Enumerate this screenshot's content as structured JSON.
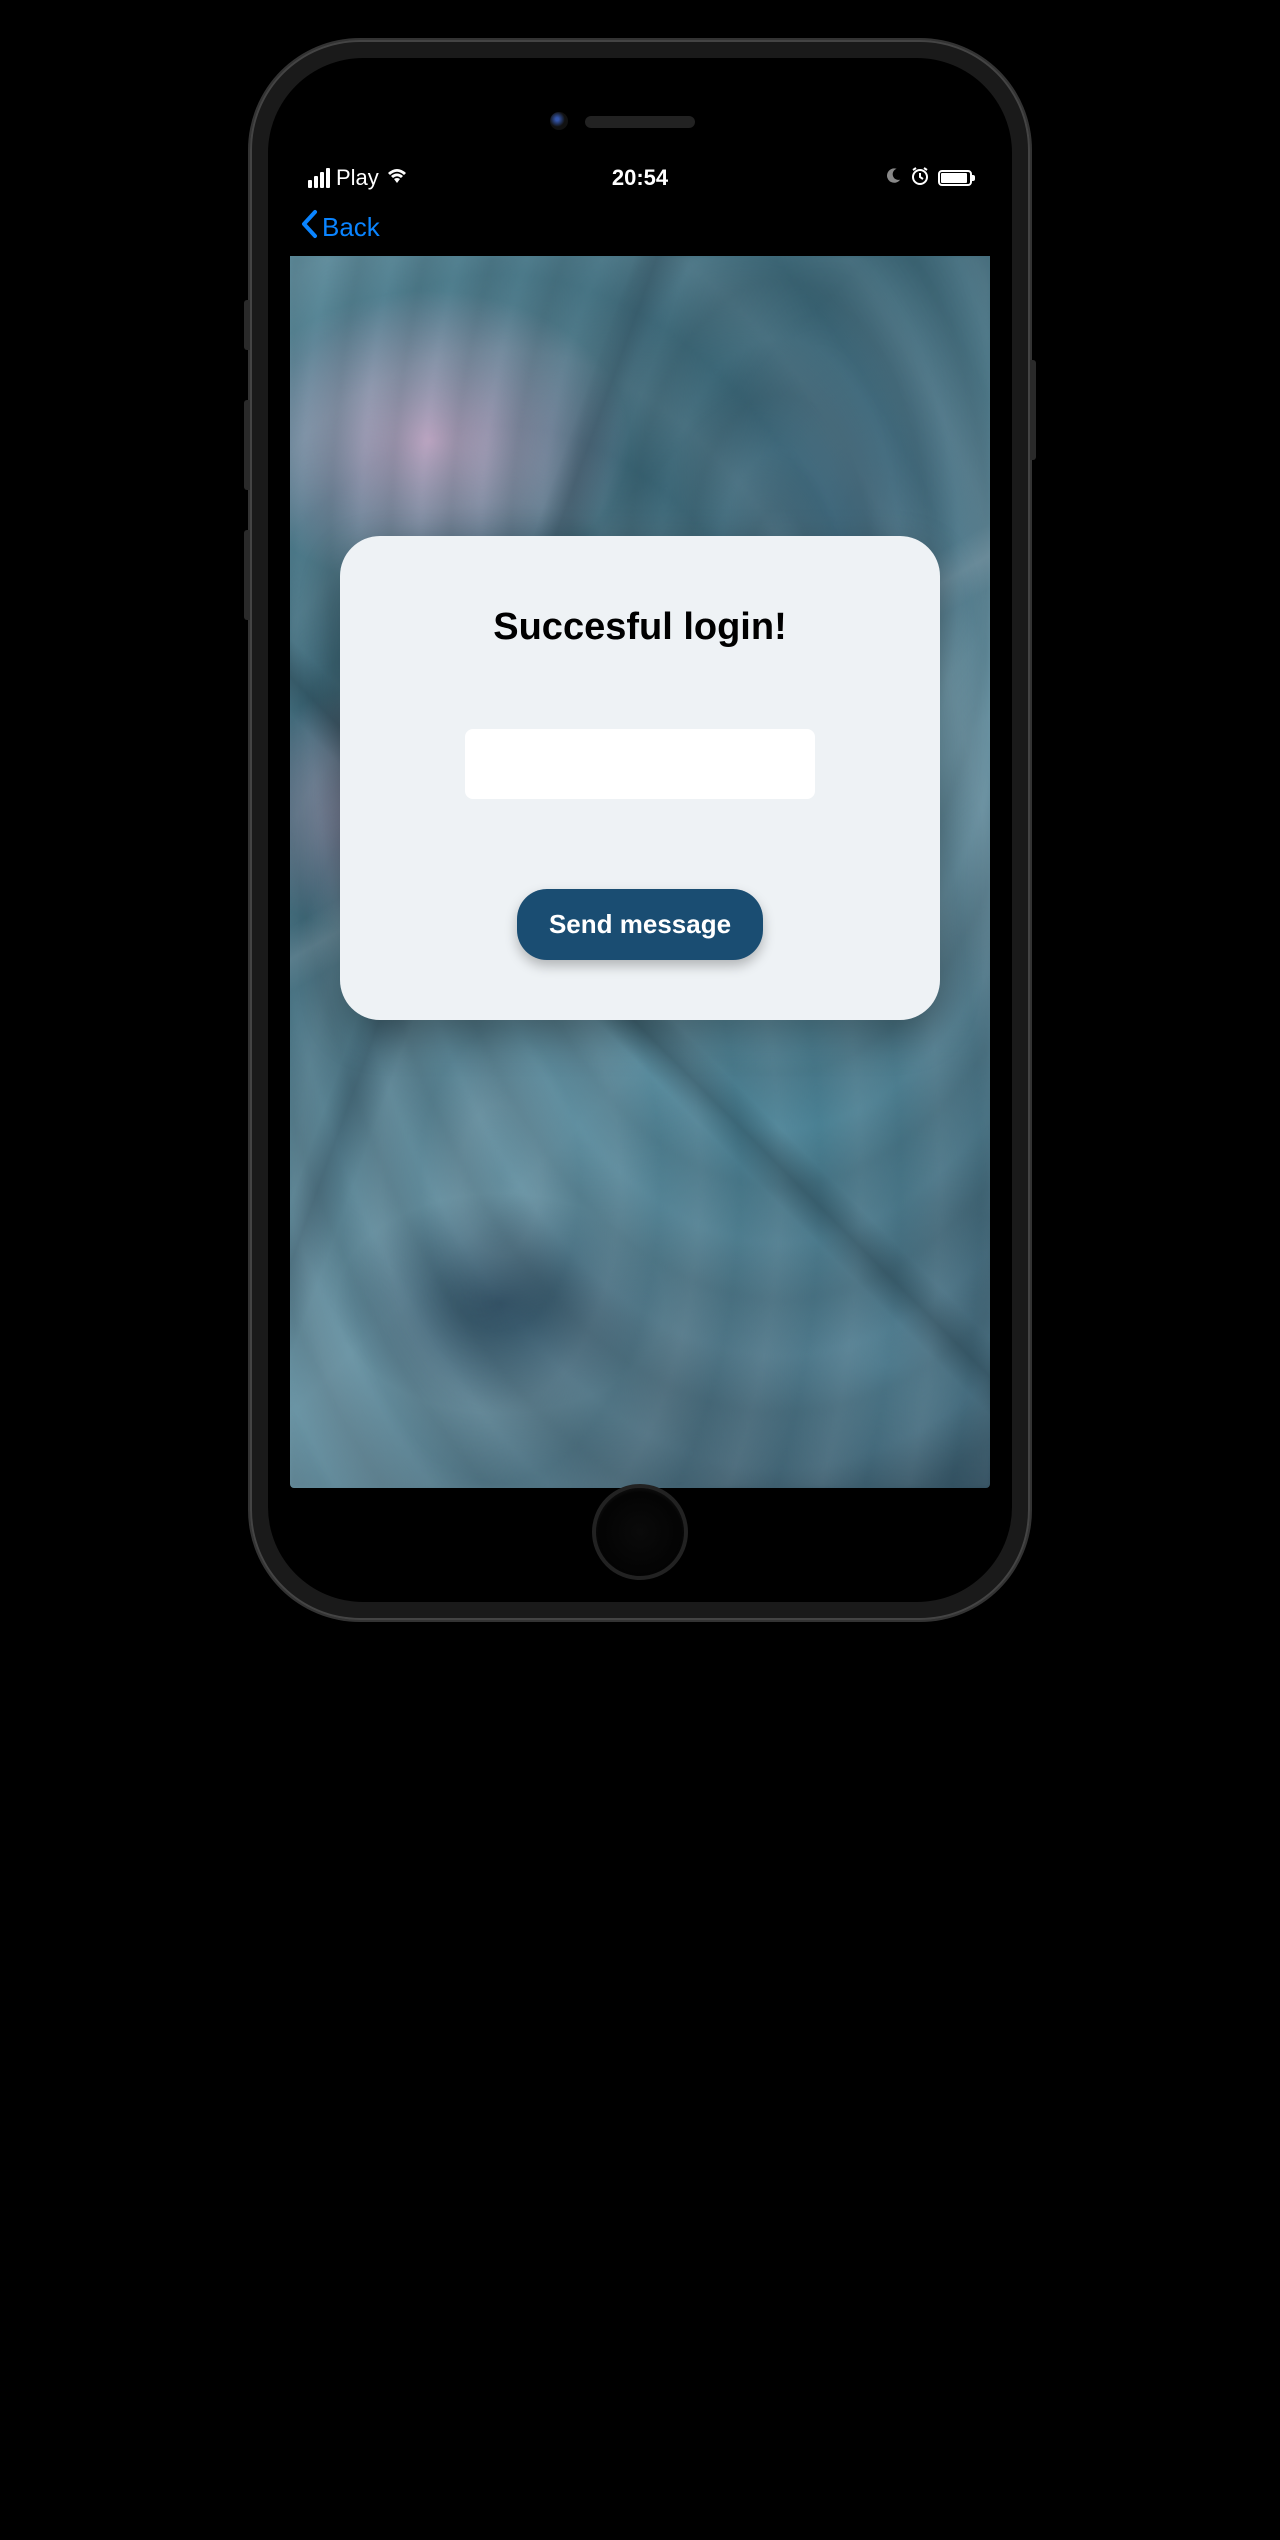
{
  "status_bar": {
    "carrier": "Play",
    "time": "20:54"
  },
  "nav": {
    "back_label": "Back"
  },
  "card": {
    "title": "Succesful login!",
    "input_value": "",
    "button_label": "Send message"
  },
  "colors": {
    "accent": "#0a84ff",
    "button_bg": "#1a4d72",
    "card_bg": "#eef2f5"
  }
}
